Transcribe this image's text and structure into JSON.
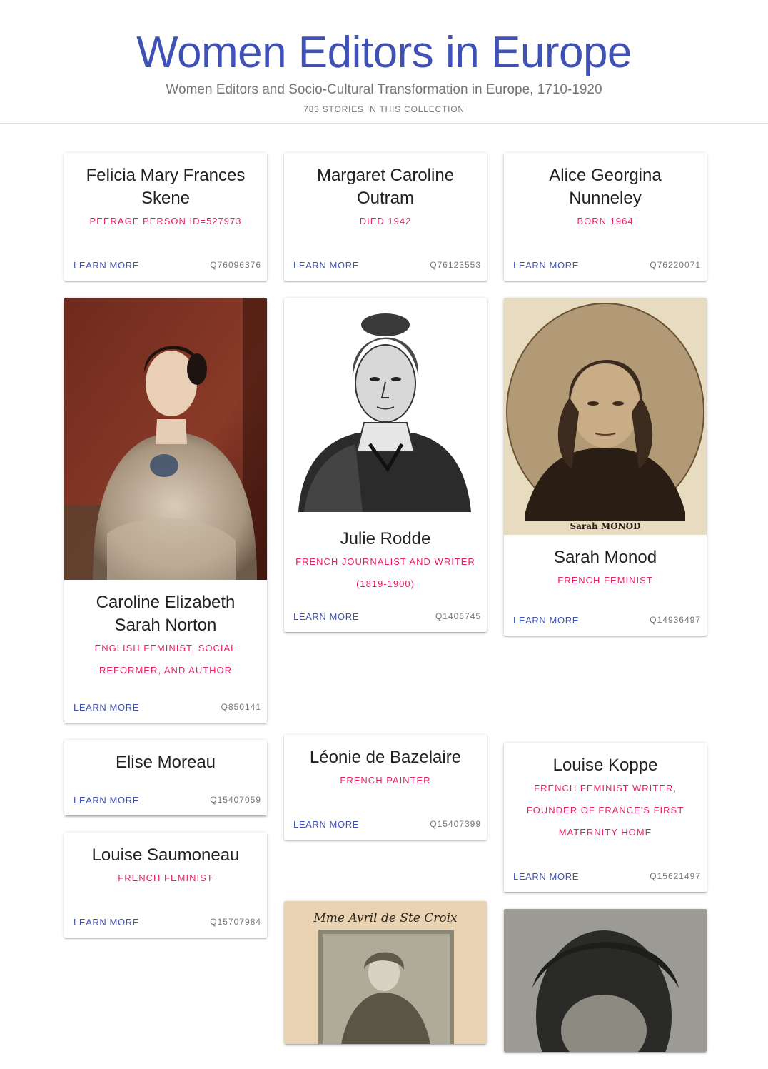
{
  "header": {
    "title": "Women Editors in Europe",
    "subtitle": "Women Editors and Socio-Cultural Transformation in Europe, 1710-1920",
    "count": "783 STORIES IN THIS COLLECTION"
  },
  "learn_more": "LEARN MORE",
  "cards": {
    "skene": {
      "name": "Felicia Mary Frances Skene",
      "desc": "PEERAGE PERSON ID=527973",
      "qid": "Q76096376"
    },
    "outram": {
      "name": "Margaret Caroline Outram",
      "desc": "DIED 1942",
      "qid": "Q76123553"
    },
    "nunneley": {
      "name": "Alice Georgina Nunneley",
      "desc": "BORN 1964",
      "qid": "Q76220071"
    },
    "norton": {
      "name": "Caroline Elizabeth Sarah Norton",
      "desc": "ENGLISH FEMINIST, SOCIAL REFORMER, AND AUTHOR",
      "qid": "Q850141"
    },
    "rodde": {
      "name": "Julie Rodde",
      "desc": "FRENCH JOURNALIST AND WRITER (1819-1900)",
      "qid": "Q1406745"
    },
    "monod": {
      "name": "Sarah Monod",
      "desc": "FRENCH FEMINIST",
      "qid": "Q14936497",
      "image_caption": "Sarah MONOD"
    },
    "moreau": {
      "name": "Elise Moreau",
      "qid": "Q15407059"
    },
    "bazelaire": {
      "name": "Léonie de Bazelaire",
      "desc": "FRENCH PAINTER",
      "qid": "Q15407399"
    },
    "koppe": {
      "name": "Louise Koppe",
      "desc": "FRENCH FEMINIST WRITER, FOUNDER OF FRANCE'S FIRST MATERNITY HOME",
      "qid": "Q15621497"
    },
    "saumoneau": {
      "name": "Louise Saumoneau",
      "desc": "FRENCH FEMINIST",
      "qid": "Q15707984"
    },
    "avril": {
      "image_caption": "Mme Avril de Ste Croix"
    }
  }
}
